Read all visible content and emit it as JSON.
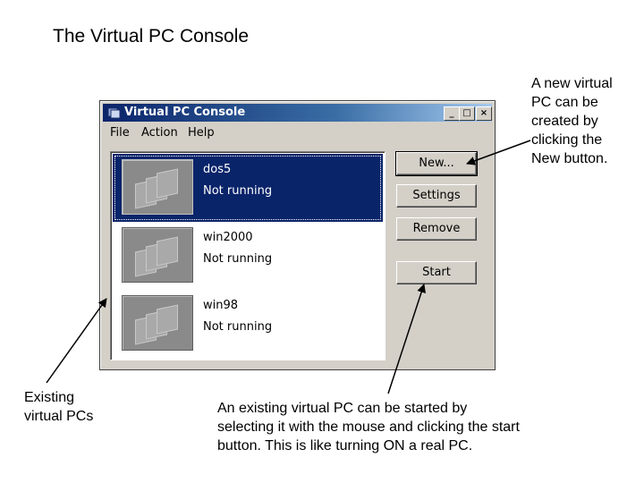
{
  "slide_title": "The Virtual PC Console",
  "annotations": {
    "new_lines": [
      "A new virtual",
      "PC can be",
      "created by",
      "clicking the",
      "New button."
    ],
    "existing_lines": [
      "Existing",
      "virtual PCs"
    ],
    "start_lines": [
      "An existing virtual PC can be started by",
      "selecting it with the mouse and clicking the start",
      "button. This is like turning ON a real PC."
    ]
  },
  "window": {
    "title": "Virtual PC Console",
    "title_icon": "virtual-pc-icon",
    "controls": {
      "minimize": "_",
      "maximize": "□",
      "close": "×"
    },
    "menu": [
      "File",
      "Action",
      "Help"
    ],
    "vms": [
      {
        "name": "dos5",
        "status": "Not running",
        "selected": true
      },
      {
        "name": "win2000",
        "status": "Not running",
        "selected": false
      },
      {
        "name": "win98",
        "status": "Not running",
        "selected": false
      }
    ],
    "buttons": {
      "new": "New...",
      "settings": "Settings",
      "remove": "Remove",
      "start": "Start"
    }
  },
  "colors": {
    "selection": "#0a246a",
    "titlebar_start": "#0a246a",
    "titlebar_end": "#a6caf0",
    "window_bg": "#d4d0c8"
  }
}
